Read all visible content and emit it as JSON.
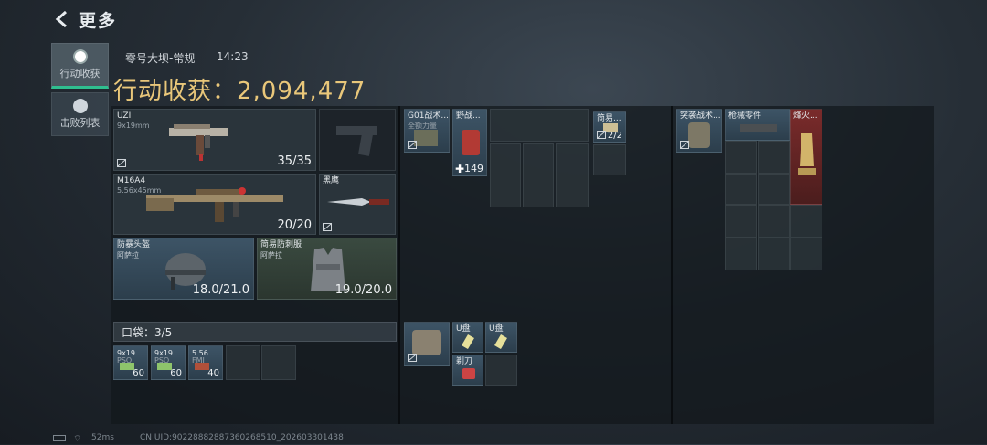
{
  "header": {
    "title": "更多"
  },
  "tabs": [
    {
      "label": "行动收获",
      "active": true,
      "icon": "target-icon"
    },
    {
      "label": "击败列表",
      "active": false,
      "icon": "skull-icon"
    }
  ],
  "raid": {
    "map": "零号大坝-常规",
    "time": "14:23"
  },
  "loot": {
    "title": "行动收获：2,094,477"
  },
  "weapons": [
    {
      "name": "UZI",
      "caliber": "9x19mm",
      "ammo": "35/35"
    },
    {
      "name": "M16A4",
      "caliber": "5.56x45mm",
      "ammo": "20/20"
    },
    {
      "name": "黑鹰"
    }
  ],
  "armor": [
    {
      "name": "防暴头盔",
      "maker": "阿萨拉",
      "durability": "18.0/21.0"
    },
    {
      "name": "简易防刺服",
      "maker": "阿萨拉",
      "durability": "19.0/20.0"
    }
  ],
  "pocket": {
    "label": "口袋：3/5",
    "items": [
      {
        "name": "9x19",
        "sub": "PSO",
        "count": "60"
      },
      {
        "name": "9x19",
        "sub": "PSO",
        "count": "60"
      },
      {
        "name": "5.56...",
        "sub": "FMJ",
        "count": "40"
      }
    ]
  },
  "chest_rig": {
    "name": "G01战术...",
    "sub": "全额力量",
    "items": [
      {
        "name": "野战...",
        "count": "149"
      },
      {
        "name": "简易...",
        "count": "2/2"
      }
    ]
  },
  "backpack": {
    "name": "突袭战术...",
    "items": [
      {
        "name": "枪械零件"
      },
      {
        "name": "烽火..."
      }
    ]
  },
  "case": {
    "items": [
      {
        "name": "U盘"
      },
      {
        "name": "U盘"
      },
      {
        "name": "剃刀"
      }
    ]
  },
  "footer": {
    "ping": "52ms",
    "uid": "CN UID:902288828873602685​10_20260330​1438"
  },
  "colors": {
    "accent_gold": "#e9c77a",
    "tab_active_underline": "#2fbf8f"
  }
}
